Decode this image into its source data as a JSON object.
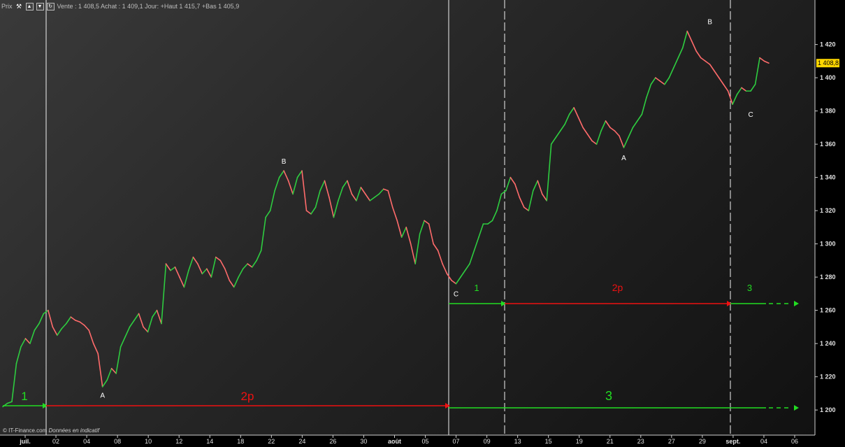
{
  "header": {
    "prefix": "Prix",
    "quote_text": "Vente : 1 408,5 Achat : 1 409,1 Jour: +Haut 1 415,7 +Bas 1 405,9"
  },
  "footer": {
    "copyright": "© IT-Finance.com",
    "note": "Données en indicatif"
  },
  "colors": {
    "up": "#2ecc40",
    "down": "#ff6b6b",
    "arrow_green": "#22dd22",
    "arrow_red": "#ee1111",
    "price_tag_bg": "#ffd700"
  },
  "chart_data": {
    "type": "line",
    "ylim": [
      1195,
      1435
    ],
    "y_ticks": [
      "1 200",
      "1 220",
      "1 240",
      "1 260",
      "1 280",
      "1 300",
      "1 320",
      "1 340",
      "1 360",
      "1 380",
      "1 400",
      "1 420"
    ],
    "y_tick_values": [
      1200,
      1220,
      1240,
      1260,
      1280,
      1300,
      1320,
      1340,
      1360,
      1380,
      1400,
      1420
    ],
    "x_ticks": [
      {
        "label": "juil.",
        "bold": true
      },
      {
        "label": "02"
      },
      {
        "label": "04"
      },
      {
        "label": "08"
      },
      {
        "label": "10"
      },
      {
        "label": "12"
      },
      {
        "label": "14"
      },
      {
        "label": "18"
      },
      {
        "label": "22"
      },
      {
        "label": "24"
      },
      {
        "label": "26"
      },
      {
        "label": "30"
      },
      {
        "label": "août",
        "bold": true
      },
      {
        "label": "05"
      },
      {
        "label": "07"
      },
      {
        "label": "09"
      },
      {
        "label": "13"
      },
      {
        "label": "15"
      },
      {
        "label": "19"
      },
      {
        "label": "21"
      },
      {
        "label": "23"
      },
      {
        "label": "27"
      },
      {
        "label": "29"
      },
      {
        "label": "sept.",
        "bold": true
      },
      {
        "label": "04"
      },
      {
        "label": "06"
      }
    ],
    "last_price": "1 408,8",
    "last_price_value": 1408.8,
    "series": [
      {
        "values": [
          1202,
          1204,
          1205,
          1228,
          1238,
          1243,
          1240,
          1248,
          1252,
          1258,
          1260,
          1250,
          1245,
          1249,
          1252,
          1256,
          1254,
          1253,
          1251,
          1248,
          1240,
          1234,
          1214,
          1218,
          1225,
          1222,
          1238,
          1244,
          1250,
          1254,
          1258,
          1250,
          1247,
          1256,
          1260,
          1252,
          1288,
          1284,
          1286,
          1280,
          1274,
          1284,
          1292,
          1288,
          1282,
          1285,
          1280,
          1292,
          1290,
          1285,
          1278,
          1274,
          1280,
          1285,
          1288,
          1286,
          1290,
          1296,
          1316,
          1320,
          1332,
          1340,
          1344,
          1338,
          1330,
          1340,
          1344,
          1320,
          1318,
          1322,
          1332,
          1338,
          1328,
          1316,
          1326,
          1334,
          1338,
          1330,
          1326,
          1334,
          1330,
          1326,
          1328,
          1330,
          1333,
          1332,
          1322,
          1314,
          1304,
          1310,
          1300,
          1288,
          1306,
          1314,
          1312,
          1300,
          1296,
          1288,
          1282,
          1278,
          1276,
          1280,
          1284,
          1288,
          1296,
          1304,
          1312,
          1312,
          1314,
          1320,
          1330,
          1332,
          1340,
          1336,
          1328,
          1322,
          1320,
          1332,
          1338,
          1330,
          1326,
          1360,
          1364,
          1368,
          1372,
          1378,
          1382,
          1376,
          1370,
          1366,
          1362,
          1360,
          1368,
          1374,
          1370,
          1368,
          1365,
          1358,
          1364,
          1370,
          1374,
          1378,
          1388,
          1396,
          1400,
          1398,
          1396,
          1400,
          1406,
          1412,
          1418,
          1428,
          1422,
          1416,
          1412,
          1410,
          1408,
          1404,
          1400,
          1396,
          1392,
          1384,
          1390,
          1394,
          1392,
          1392,
          1396,
          1412,
          1410,
          1408.8
        ]
      }
    ],
    "wave_labels": [
      {
        "text": "A",
        "value": 1215,
        "index": 22,
        "place": "below"
      },
      {
        "text": "B",
        "value": 1344,
        "index": 62,
        "place": "above"
      },
      {
        "text": "C",
        "value": 1276,
        "index": 100,
        "place": "below"
      },
      {
        "text": "A",
        "value": 1358,
        "index": 137,
        "place": "below"
      },
      {
        "text": "B",
        "value": 1428,
        "index": 156,
        "place": "above"
      },
      {
        "text": "C",
        "value": 1384,
        "index": 165,
        "place": "below"
      }
    ],
    "count_labels": [
      {
        "text": "1",
        "color": "green",
        "size": 17,
        "lane": "bottom",
        "seg": 0
      },
      {
        "text": "2p",
        "color": "red",
        "size": 17,
        "lane": "bottom",
        "seg": 1
      },
      {
        "text": "3",
        "color": "green",
        "size": 18,
        "lane": "bottom",
        "seg": 2
      },
      {
        "text": "1",
        "color": "green",
        "size": 13,
        "lane": "top",
        "seg": 0
      },
      {
        "text": "2p",
        "color": "red",
        "size": 14,
        "lane": "top",
        "seg": 1
      },
      {
        "text": "3",
        "color": "green",
        "size": 13,
        "lane": "top",
        "seg": 2
      }
    ]
  }
}
